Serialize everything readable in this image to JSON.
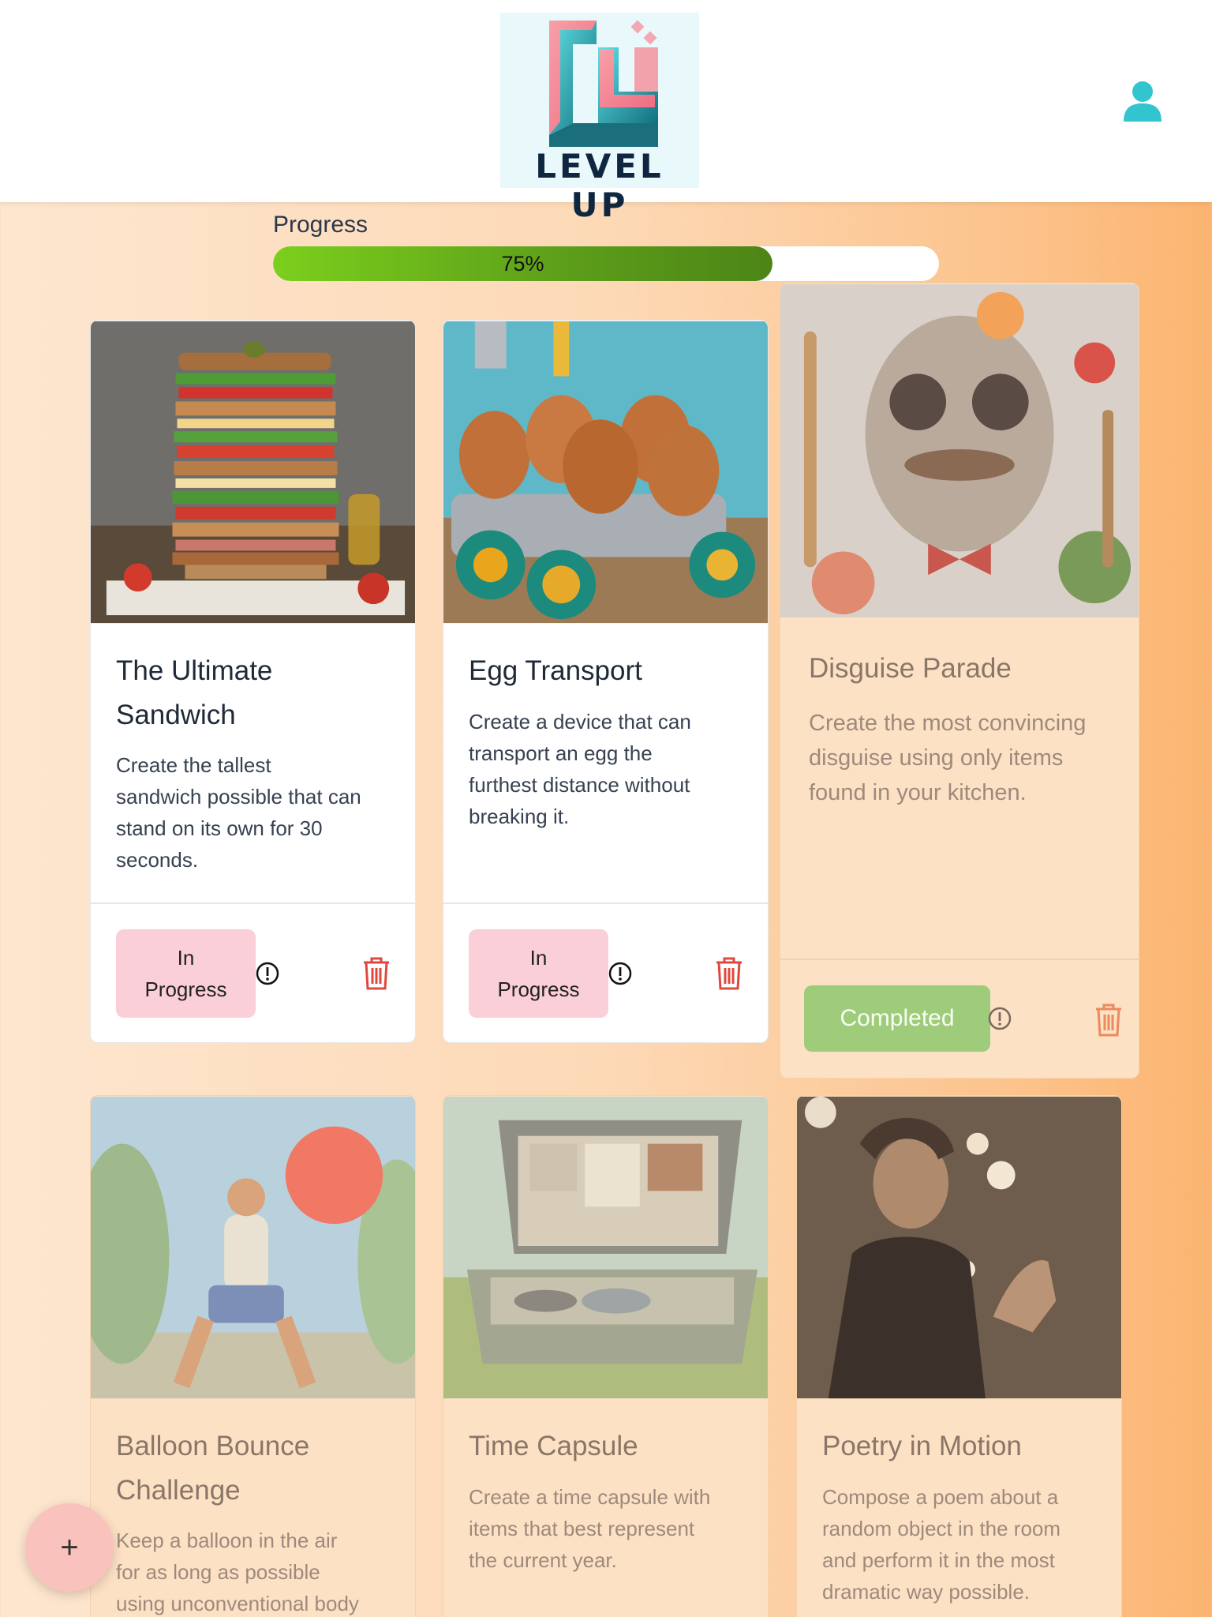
{
  "header": {
    "logo_text": "LEVEL UP",
    "logo_icon": "level-up-logo",
    "profile_icon": "user-icon"
  },
  "progress": {
    "label": "Progress",
    "value_text": "75%",
    "fraction": 0.75
  },
  "cards": [
    {
      "title_lines": [
        "The Ultimate",
        "Sandwich"
      ],
      "description_lines": [
        "Create the tallest",
        "sandwich possible that can",
        "stand on its own for 30",
        "seconds."
      ],
      "status_lines": [
        "In",
        "Progress"
      ],
      "status": "in-progress",
      "image": "tall-sandwich-photo"
    },
    {
      "title_lines": [
        "Egg Transport"
      ],
      "description_lines": [
        "Create a device that can",
        "transport an egg the",
        "furthest distance without",
        "breaking it."
      ],
      "status_lines": [
        "In",
        "Progress"
      ],
      "status": "in-progress",
      "image": "egg-cart-photo"
    },
    {
      "title_lines": [
        "Disguise Parade"
      ],
      "description_lines": [
        "Create the most convincing",
        "disguise using only items",
        "found in your kitchen."
      ],
      "status_lines": [
        "Completed"
      ],
      "status": "completed",
      "image": "kitchen-face-photo"
    },
    {
      "title_lines": [
        "Balloon Bounce",
        "Challenge"
      ],
      "description_lines": [
        "Keep a balloon in the air",
        "for as long as possible",
        "using unconventional body"
      ],
      "image": "balloon-athlete-photo"
    },
    {
      "title_lines": [
        "Time Capsule"
      ],
      "description_lines": [
        "Create a time capsule with",
        "items that best represent",
        "the current year."
      ],
      "image": "time-capsule-photo"
    },
    {
      "title_lines": [
        "Poetry in Motion"
      ],
      "description_lines": [
        "Compose a poem about a",
        "random object in the room",
        "and perform it in the most",
        "dramatic way possible."
      ],
      "image": "dramatic-poet-photo"
    }
  ],
  "fab": {
    "label": "+"
  },
  "colors": {
    "accent_teal": "#33c5cf",
    "progress_green": "#5c9d1a",
    "status_pink": "#fbcfd7",
    "completed_green": "#9fcc7b",
    "trash_red": "#e0483e"
  }
}
